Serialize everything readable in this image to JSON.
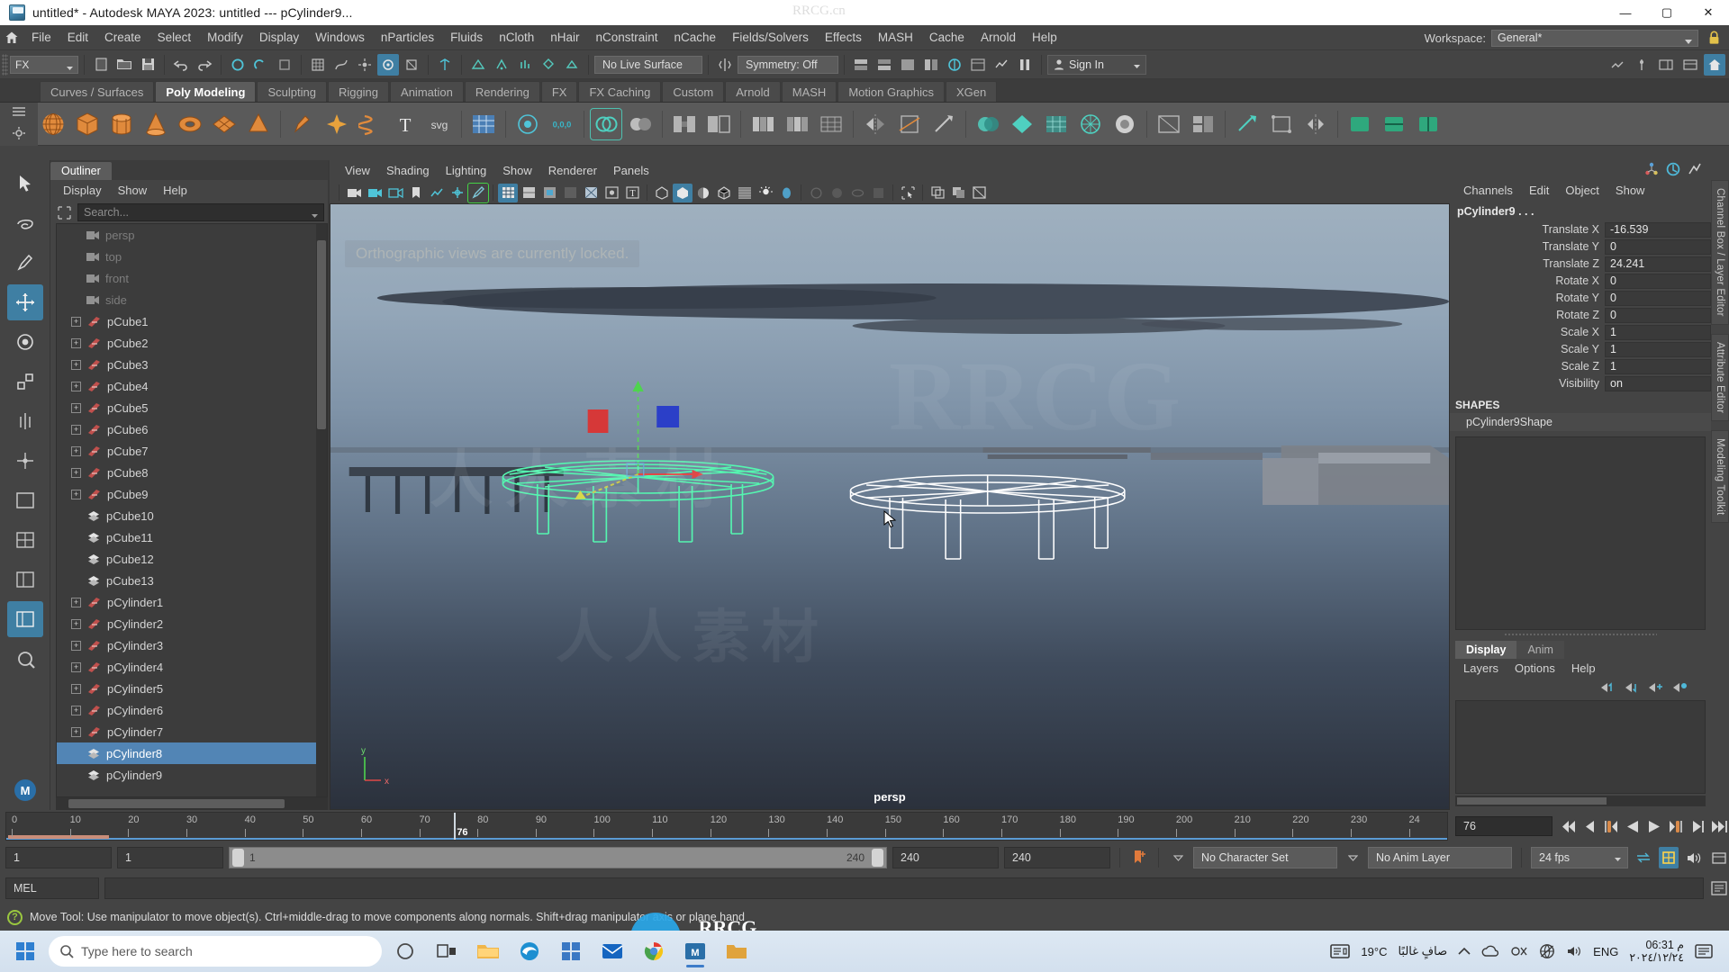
{
  "window": {
    "title": "untitled* - Autodesk MAYA 2023: untitled   ---   pCylinder9...",
    "minimize": "—",
    "maximize": "▢",
    "close": "✕",
    "watermark_top": "RRCG.cn"
  },
  "menubar": {
    "items": [
      "File",
      "Edit",
      "Create",
      "Select",
      "Modify",
      "Display",
      "Windows",
      "nParticles",
      "Fluids",
      "nCloth",
      "nHair",
      "nConstraint",
      "nCache",
      "Fields/Solvers",
      "Effects",
      "MASH",
      "Cache",
      "Arnold",
      "Help"
    ],
    "workspace_label": "Workspace:",
    "workspace_value": "General*"
  },
  "statusline": {
    "menuset": "FX",
    "live_surface": "No Live Surface",
    "symmetry": "Symmetry: Off",
    "signin": "Sign In"
  },
  "shelf": {
    "tabs": [
      "Curves / Surfaces",
      "Poly Modeling",
      "Sculpting",
      "Rigging",
      "Animation",
      "Rendering",
      "FX",
      "FX Caching",
      "Custom",
      "Arnold",
      "MASH",
      "Motion Graphics",
      "XGen"
    ],
    "active_tab": "Poly Modeling",
    "text_icons": {
      "svg": "svg",
      "text": "T",
      "zero": "0,0,0"
    }
  },
  "outliner": {
    "tab": "Outliner",
    "menu": [
      "Display",
      "Show",
      "Help"
    ],
    "search_placeholder": "Search...",
    "items": [
      {
        "label": "persp",
        "icon": "camera-icon",
        "dim": true,
        "expandable": false
      },
      {
        "label": "top",
        "icon": "camera-icon",
        "dim": true,
        "expandable": false
      },
      {
        "label": "front",
        "icon": "camera-icon",
        "dim": true,
        "expandable": false
      },
      {
        "label": "side",
        "icon": "camera-icon",
        "dim": true,
        "expandable": false
      },
      {
        "label": "pCube1",
        "icon": "transform-icon",
        "dim": false,
        "expandable": true
      },
      {
        "label": "pCube2",
        "icon": "transform-icon",
        "dim": false,
        "expandable": true
      },
      {
        "label": "pCube3",
        "icon": "transform-icon",
        "dim": false,
        "expandable": true
      },
      {
        "label": "pCube4",
        "icon": "transform-icon",
        "dim": false,
        "expandable": true
      },
      {
        "label": "pCube5",
        "icon": "transform-icon",
        "dim": false,
        "expandable": true
      },
      {
        "label": "pCube6",
        "icon": "transform-icon",
        "dim": false,
        "expandable": true
      },
      {
        "label": "pCube7",
        "icon": "transform-icon",
        "dim": false,
        "expandable": true
      },
      {
        "label": "pCube8",
        "icon": "transform-icon",
        "dim": false,
        "expandable": true
      },
      {
        "label": "pCube9",
        "icon": "transform-icon",
        "dim": false,
        "expandable": true
      },
      {
        "label": "pCube10",
        "icon": "mesh-icon",
        "dim": false,
        "expandable": false
      },
      {
        "label": "pCube11",
        "icon": "mesh-icon",
        "dim": false,
        "expandable": false
      },
      {
        "label": "pCube12",
        "icon": "mesh-icon",
        "dim": false,
        "expandable": false
      },
      {
        "label": "pCube13",
        "icon": "mesh-icon",
        "dim": false,
        "expandable": false
      },
      {
        "label": "pCylinder1",
        "icon": "transform-icon",
        "dim": false,
        "expandable": true
      },
      {
        "label": "pCylinder2",
        "icon": "transform-icon",
        "dim": false,
        "expandable": true
      },
      {
        "label": "pCylinder3",
        "icon": "transform-icon",
        "dim": false,
        "expandable": true
      },
      {
        "label": "pCylinder4",
        "icon": "transform-icon",
        "dim": false,
        "expandable": true
      },
      {
        "label": "pCylinder5",
        "icon": "transform-icon",
        "dim": false,
        "expandable": true
      },
      {
        "label": "pCylinder6",
        "icon": "transform-icon",
        "dim": false,
        "expandable": true
      },
      {
        "label": "pCylinder7",
        "icon": "transform-icon",
        "dim": false,
        "expandable": true
      },
      {
        "label": "pCylinder8",
        "icon": "mesh-icon",
        "dim": false,
        "expandable": false,
        "selected": true
      },
      {
        "label": "pCylinder9",
        "icon": "mesh-icon",
        "dim": false,
        "expandable": false
      }
    ]
  },
  "viewport": {
    "menu": [
      "View",
      "Shading",
      "Lighting",
      "Show",
      "Renderer",
      "Panels"
    ],
    "notice": "Orthographic views are currently locked.",
    "camera_label": "persp",
    "axis_y": "y",
    "axis_x": "x"
  },
  "channelbox": {
    "tabs": [
      "Channels",
      "Edit",
      "Object",
      "Show"
    ],
    "object_name": "pCylinder9 . . .",
    "attributes": [
      {
        "label": "Translate X",
        "value": "-16.539"
      },
      {
        "label": "Translate Y",
        "value": "0"
      },
      {
        "label": "Translate Z",
        "value": "24.241"
      },
      {
        "label": "Rotate X",
        "value": "0"
      },
      {
        "label": "Rotate Y",
        "value": "0"
      },
      {
        "label": "Rotate Z",
        "value": "0"
      },
      {
        "label": "Scale X",
        "value": "1"
      },
      {
        "label": "Scale Y",
        "value": "1"
      },
      {
        "label": "Scale Z",
        "value": "1"
      },
      {
        "label": "Visibility",
        "value": "on"
      }
    ],
    "shapes_header": "SHAPES",
    "shape_name": "pCylinder9Shape",
    "side_tabs": [
      "Channel Box / Layer Editor",
      "Attribute Editor",
      "Modeling Toolkit"
    ]
  },
  "layers": {
    "tabs": [
      "Display",
      "Anim"
    ],
    "active_tab": "Display",
    "menu": [
      "Layers",
      "Options",
      "Help"
    ]
  },
  "timeline": {
    "ticks": [
      "0",
      "10",
      "20",
      "30",
      "40",
      "50",
      "60",
      "70",
      "80",
      "90",
      "100",
      "110",
      "120",
      "130",
      "140",
      "150",
      "160",
      "170",
      "180",
      "190",
      "200",
      "210",
      "220",
      "230",
      "24"
    ],
    "current_frame": "76",
    "current_frame_field": "76"
  },
  "range": {
    "start": "1",
    "playback_start": "1",
    "slider_min": "1",
    "slider_max": "240",
    "playback_end": "240",
    "end": "240",
    "character_set": "No Character Set",
    "anim_layer": "No Anim Layer",
    "fps": "24 fps"
  },
  "helpline": {
    "text": "Move Tool: Use manipulator to move object(s). Ctrl+middle-drag to move components along normals. Shift+drag manipulator axis or plane hand",
    "mel": "MEL"
  },
  "taskbar": {
    "search_placeholder": "Type here to search",
    "temperature": "19°C",
    "weather": "صافٍ غالبًا",
    "language": "ENG",
    "time": "06:31 م",
    "date": "٢٠٢٤/١٢/٢٤"
  },
  "watermarks": {
    "left": "人人素材",
    "center": "人人素材",
    "rrcg": "RRCG",
    "logo_text": "RRCG",
    "logo_sub": "人人素材"
  },
  "colors": {
    "accent_blue": "#3f7fa3",
    "selection_blue": "#5285b5",
    "shelf_bg": "#5a5a5a",
    "panel_bg": "#444444",
    "list_bg": "#3c3c3c",
    "green_highlight": "#44d245"
  }
}
